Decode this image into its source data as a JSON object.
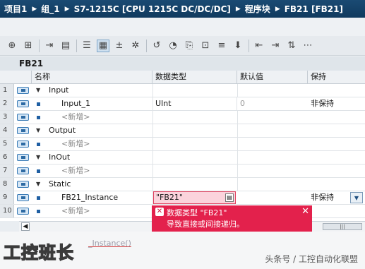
{
  "breadcrumb": {
    "items": [
      "项目1",
      "组_1",
      "S7-1215C [CPU 1215C DC/DC/DC]",
      "程序块",
      "FB21 [FB21]"
    ],
    "separator": "▶"
  },
  "toolbar": {
    "icons": [
      "insert-row-icon",
      "add-row-icon",
      "export-icon",
      "database-icon",
      "list-view-icon",
      "block-view-icon",
      "load-start-icon",
      "snapshot-icon",
      "reset-icon",
      "monitor-icon",
      "copy-values-icon",
      "apply-values-icon",
      "load-values-icon",
      "download-icon",
      "indent-left-icon",
      "indent-right-icon",
      "sort-icon",
      "more-icon"
    ]
  },
  "block_title": "FB21",
  "columns": {
    "name": "名称",
    "type": "数据类型",
    "default": "默认值",
    "retain": "保持"
  },
  "rows": [
    {
      "num": "1",
      "kind": "section",
      "name": "Input",
      "type": "",
      "default": "",
      "retain": ""
    },
    {
      "num": "2",
      "kind": "var",
      "name": "Input_1",
      "type": "UInt",
      "default": "0",
      "retain": "非保持"
    },
    {
      "num": "3",
      "kind": "add",
      "name": "<新增>",
      "type": "",
      "default": "",
      "retain": ""
    },
    {
      "num": "4",
      "kind": "section",
      "name": "Output",
      "type": "",
      "default": "",
      "retain": ""
    },
    {
      "num": "5",
      "kind": "add",
      "name": "<新增>",
      "type": "",
      "default": "",
      "retain": ""
    },
    {
      "num": "6",
      "kind": "section",
      "name": "InOut",
      "type": "",
      "default": "",
      "retain": ""
    },
    {
      "num": "7",
      "kind": "add",
      "name": "<新增>",
      "type": "",
      "default": "",
      "retain": ""
    },
    {
      "num": "8",
      "kind": "section",
      "name": "Static",
      "type": "",
      "default": "",
      "retain": ""
    },
    {
      "num": "9",
      "kind": "var",
      "name": "FB21_Instance",
      "type": "\"FB21\"",
      "default": "",
      "retain": "非保持"
    },
    {
      "num": "10",
      "kind": "add",
      "name": "<新增>",
      "type": "",
      "default": "",
      "retain": ""
    }
  ],
  "error": {
    "line1": "数据类型 \"FB21\"",
    "line2": "导致直接或间接递归。"
  },
  "ghost_text": "_Instance()",
  "watermark": "工控班长",
  "credit": "头条号 / 工控自动化联盟",
  "colors": {
    "header_bar": "#15446b",
    "error_bg": "#e3214c",
    "edit_bg": "#fbd3dc"
  }
}
